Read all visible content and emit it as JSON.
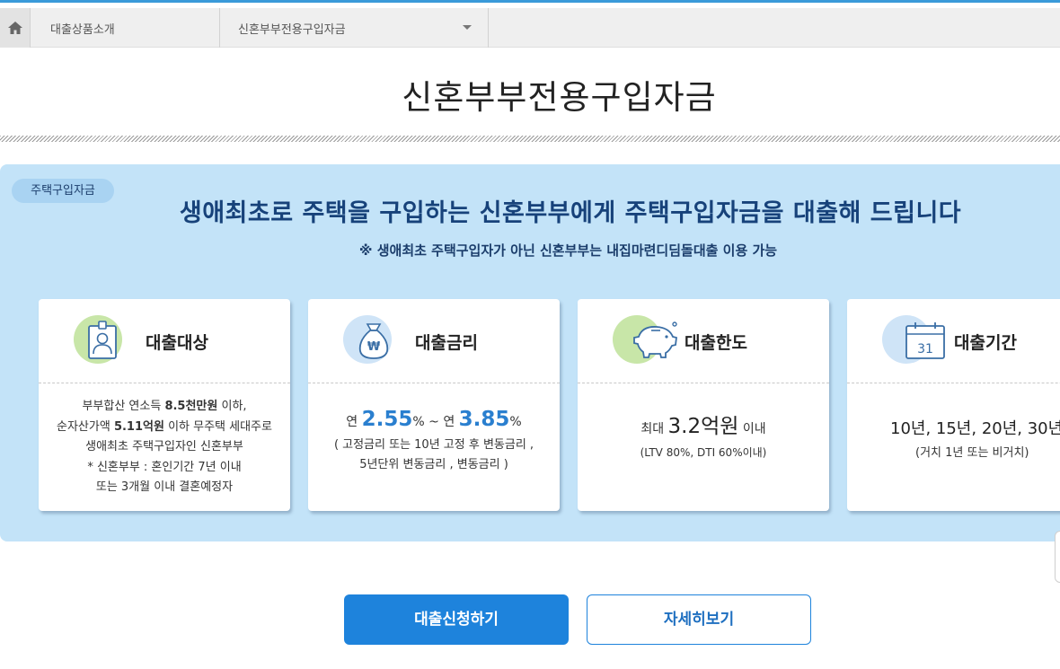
{
  "breadcrumb": {
    "item1": "대출상품소개",
    "item2": "신혼부부전용구입자금"
  },
  "page": {
    "title": "신혼부부전용구입자금"
  },
  "banner": {
    "tag": "주택구입자금",
    "headline": "생애최초로 주택을 구입하는 신혼부부에게  주택구입자금을 대출해 드립니다",
    "subline": "※ 생애최초 주택구입자가 아닌 신혼부부는 내집마련디딤돌대출 이용 가능"
  },
  "cards": {
    "target": {
      "title": "대출대상",
      "icon": "id-badge-icon",
      "line1_pre": "부부합산 연소득 ",
      "line1_bold": "8.5천만원",
      "line1_post": " 이하,",
      "line2_pre": "순자산가액 ",
      "line2_bold": "5.11억원",
      "line2_post": " 이하 무주택 세대주로",
      "line3": "생애최초 주택구입자인 신혼부부",
      "line4": "* 신혼부부 : 혼인기간 7년 이내",
      "line5": "또는 3개월 이내 결혼예정자"
    },
    "rate": {
      "title": "대출금리",
      "icon": "money-bag-icon",
      "prefix1": "연 ",
      "value1": "2.55",
      "unit1": "%",
      "sep": " ~ 연 ",
      "value2": "3.85",
      "unit2": "%",
      "note1": "( 고정금리 또는 10년 고정 후 변동금리 ,",
      "note2": "5년단위 변동금리 , 변동금리 )"
    },
    "limit": {
      "title": "대출한도",
      "icon": "piggy-bank-icon",
      "prefix": "최대 ",
      "value": "3.2억원",
      "suffix": " 이내",
      "note": "(LTV 80%, DTI 60%이내)"
    },
    "period": {
      "title": "대출기간",
      "icon": "calendar-icon",
      "calendar_day": "31",
      "value": "10년, 15년, 20년, 30년",
      "note": "(거치 1년 또는 비거치)"
    }
  },
  "buttons": {
    "apply": "대출신청하기",
    "detail": "자세히보기"
  },
  "colors": {
    "accent": "#1e83dc",
    "panel": "#c3e3f8",
    "headline": "#17427a",
    "green_circle": "#c8e6a8",
    "blue_circle": "#cfe4f7"
  }
}
